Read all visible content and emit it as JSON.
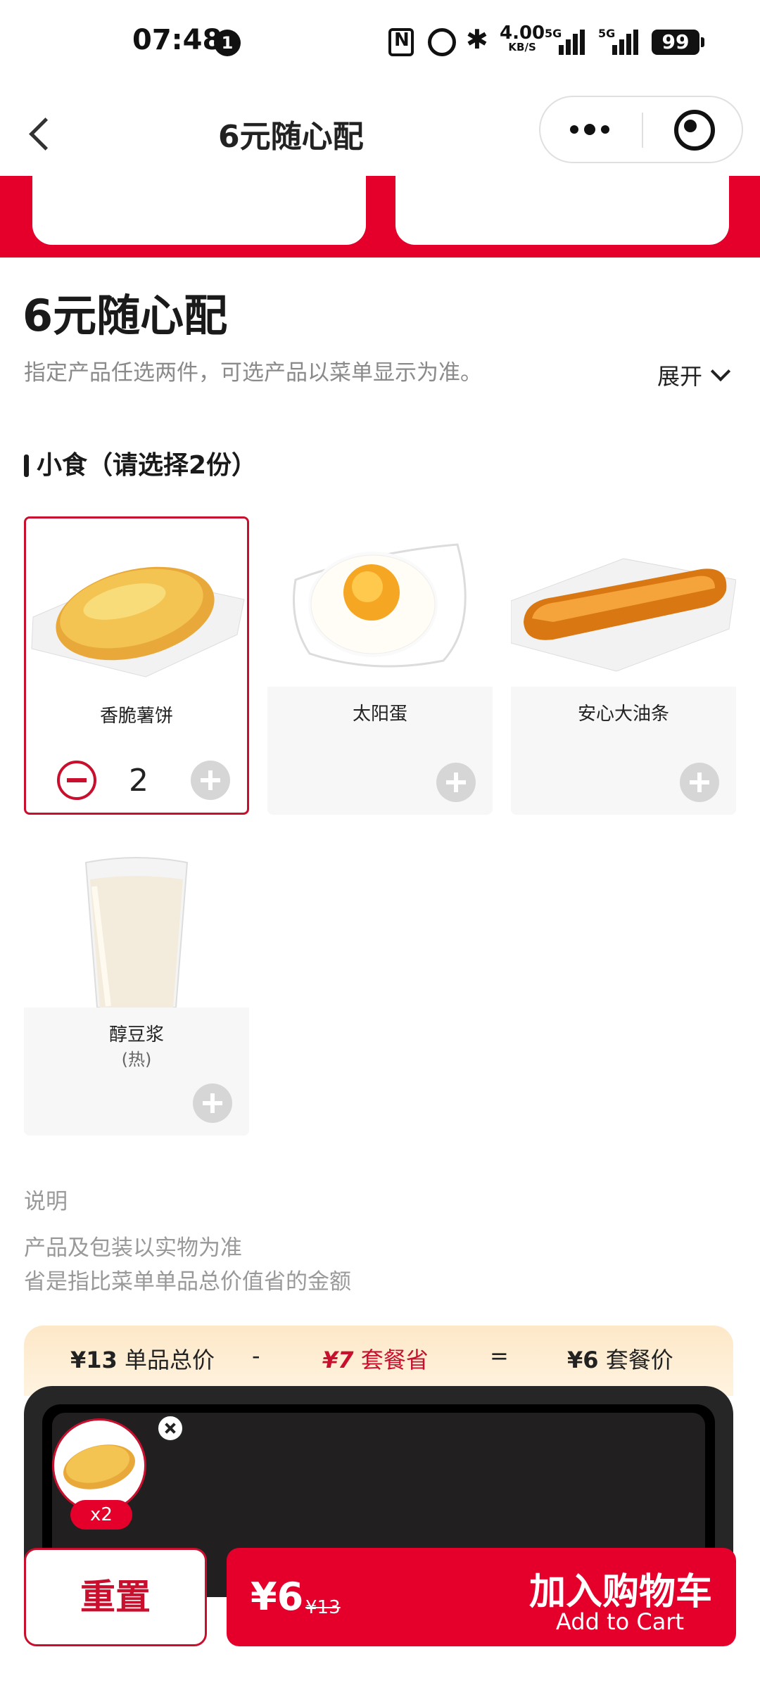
{
  "status_bar": {
    "time": "07:48",
    "notification_count": "1",
    "speed_value": "4.00",
    "speed_unit": "KB/S",
    "network_1": "5G",
    "network_2": "5G",
    "battery": "99",
    "icons": [
      "nfc-icon",
      "alarm-icon",
      "bluetooth-icon",
      "signal-icon",
      "signal-icon",
      "battery-icon"
    ]
  },
  "nav": {
    "title": "6元随心配"
  },
  "combo": {
    "title": "6元随心配",
    "description": "指定产品任选两件，可选产品以菜单显示为准。",
    "expand_label": "展开"
  },
  "section": {
    "heading": "小食（请选择2份）"
  },
  "products": [
    {
      "name": "香脆薯饼",
      "sub": "",
      "selected": true,
      "quantity": "2"
    },
    {
      "name": "太阳蛋",
      "sub": "",
      "selected": false
    },
    {
      "name": "安心大油条",
      "sub": "",
      "selected": false
    },
    {
      "name": "醇豆浆",
      "sub": "(热)",
      "selected": false
    }
  ],
  "notes": {
    "label": "说明",
    "lines": [
      "产品及包装以实物为准",
      "省是指比菜单单品总价值省的金额"
    ]
  },
  "price_summary": {
    "single_total": "¥13",
    "single_total_label": "单品总价",
    "minus": "-",
    "saving": "¥7",
    "saving_label": "套餐省",
    "equals": "=",
    "combo_price": "¥6",
    "combo_price_label": "套餐价"
  },
  "tray": {
    "item_count": "x2"
  },
  "actions": {
    "reset_label": "重置",
    "price": "¥6",
    "original_price": "¥13",
    "add_to_cart_cn": "加入购物车",
    "add_to_cart_en": "Add to Cart"
  },
  "colors": {
    "brand_red": "#e4002b",
    "accent_red": "#c8102e"
  }
}
